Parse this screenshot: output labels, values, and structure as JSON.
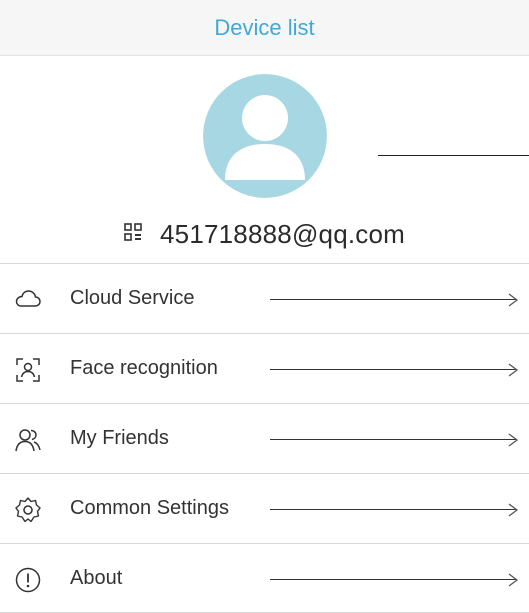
{
  "header": {
    "title": "Device list"
  },
  "profile": {
    "account": "451718888@qq.com"
  },
  "menu": {
    "items": [
      {
        "label": "Cloud Service",
        "icon": "cloud-icon"
      },
      {
        "label": "Face recognition",
        "icon": "face-recognition-icon"
      },
      {
        "label": "My Friends",
        "icon": "friends-icon"
      },
      {
        "label": "Common Settings",
        "icon": "gear-icon"
      },
      {
        "label": "About",
        "icon": "info-icon"
      }
    ]
  },
  "colors": {
    "accent": "#3fa9d8",
    "avatar": "#a8d7e4",
    "header_bg": "#f6f6f6"
  }
}
